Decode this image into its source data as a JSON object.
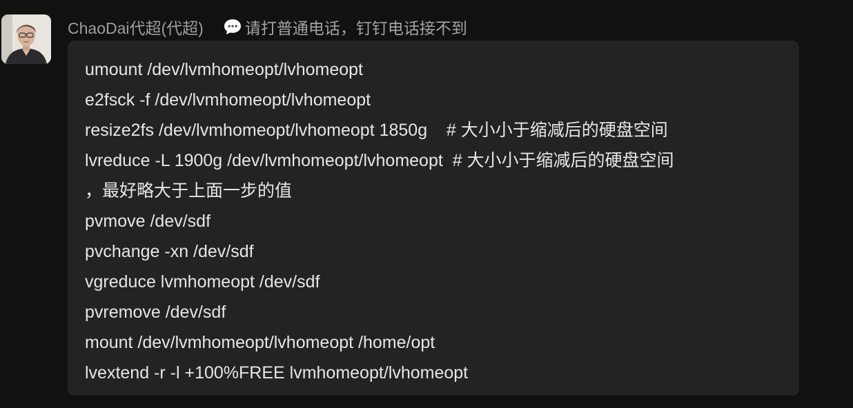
{
  "message": {
    "sender": "ChaoDai代超(代超)",
    "status_text": "请打普通电话，钉钉电话接不到",
    "status_icon": "speech-bubble-icon",
    "colors": {
      "background": "#111111",
      "bubble": "#232323",
      "text": "#e6e6e6",
      "meta": "#9d9d9d"
    },
    "lines": [
      "umount /dev/lvmhomeopt/lvhomeopt",
      "e2fsck -f /dev/lvmhomeopt/lvhomeopt",
      "resize2fs /dev/lvmhomeopt/lvhomeopt 1850g    # 大小小于缩减后的硬盘空间",
      "lvreduce -L 1900g /dev/lvmhomeopt/lvhomeopt  # 大小小于缩减后的硬盘空间",
      "，最好略大于上面一步的值",
      "pvmove /dev/sdf",
      "pvchange -xn /dev/sdf",
      "vgreduce lvmhomeopt /dev/sdf",
      "pvremove /dev/sdf",
      "mount /dev/lvmhomeopt/lvhomeopt /home/opt",
      "lvextend -r -l +100%FREE lvmhomeopt/lvhomeopt"
    ]
  }
}
